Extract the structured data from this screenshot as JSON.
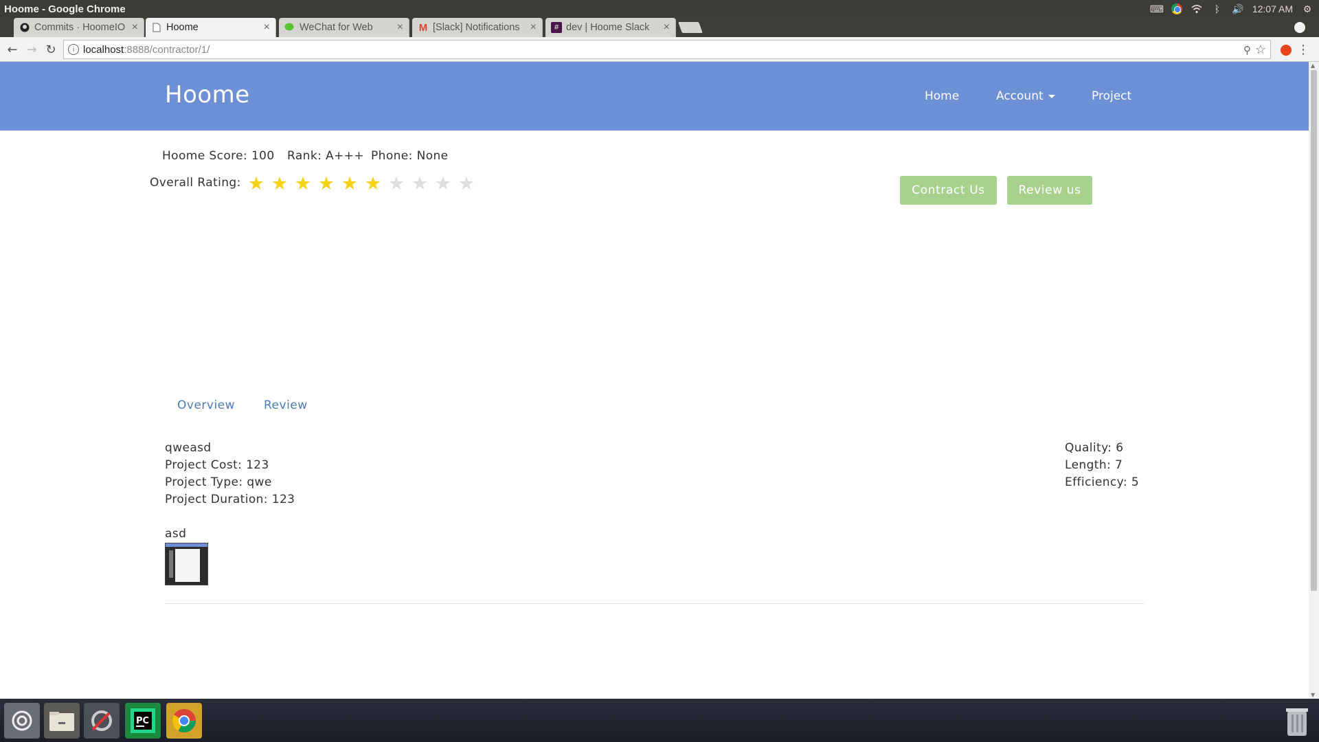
{
  "os": {
    "window_title": "Hoome - Google Chrome",
    "clock": "12:07 AM"
  },
  "browser": {
    "tabs": [
      {
        "label": "Commits · HoomeIO",
        "favicon": "github-icon"
      },
      {
        "label": "Hoome",
        "favicon": "page-icon"
      },
      {
        "label": "WeChat for Web",
        "favicon": "wechat-icon"
      },
      {
        "label": "[Slack] Notifications",
        "favicon": "gmail-icon"
      },
      {
        "label": "dev | Hoome Slack",
        "favicon": "slack-icon"
      }
    ],
    "active_tab": 1,
    "url_host": "localhost",
    "url_path": ":8888/contractor/1/"
  },
  "site": {
    "brand": "Hoome",
    "nav": {
      "home": "Home",
      "account": "Account",
      "project": "Project"
    }
  },
  "contractor": {
    "score_text": "Hoome Score: 100",
    "rank_text": "Rank: A+++",
    "phone_text": "Phone: None",
    "rating_label": "Overall Rating:",
    "rating": 6,
    "rating_max": 10,
    "star_filled_color": "#f5d316",
    "star_empty_color": "#dddddd"
  },
  "actions": {
    "contract": "Contract Us",
    "review": "Review us"
  },
  "tabs": {
    "overview": "Overview",
    "review": "Review"
  },
  "project": {
    "name": "qweasd",
    "cost": "Project Cost: 123",
    "type": "Project Type: qwe",
    "duration": "Project Duration: 123",
    "note": "asd"
  },
  "scores": {
    "quality": "Quality: 6",
    "length": "Length: 7",
    "efficiency": "Efficiency: 5"
  },
  "colors": {
    "nav_bg": "#6d8fd6",
    "button_green": "#a9d18e",
    "link_blue": "#4a7cb8"
  }
}
